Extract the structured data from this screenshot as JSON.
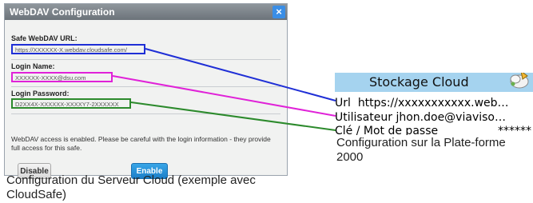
{
  "dialog": {
    "title": "WebDAV Configuration",
    "close_glyph": "×",
    "url_label": "Safe WebDAV URL:",
    "url_value": "https://XXXXXX-X.webdav.cloudsafe.com/",
    "login_label": "Login Name:",
    "login_value": "XXXXXX-XXXX@dsu.com",
    "password_label": "Login Password:",
    "password_value": "D2XX4X-XXXXXX-XXXXY7-2XXXXXX",
    "warning": "WebDAV access is enabled. Please be careful with the login information - they provide full access for this safe.",
    "disable_label": "Disable",
    "enable_label": "Enable"
  },
  "caption_left": "Configuration du Serveur Cloud (exemple avec CloudSafe)",
  "panel": {
    "title": "Stockage Cloud",
    "rows": [
      {
        "label": "Url",
        "value": "https://xxxxxxxxxxx.web…"
      },
      {
        "label": "Utilisateur",
        "value": "jhon.doe@viaviso…"
      },
      {
        "label": "Clé / Mot de passe",
        "value": "******"
      }
    ],
    "icon": "cloud-storage-icon"
  },
  "caption_right": "Configuration sur la Plate-forme 2000",
  "colors": {
    "url_highlight": "#1f2fd6",
    "login_highlight": "#e022d8",
    "password_highlight": "#2c8a2c",
    "panel_header": "#a5d3ef",
    "enable_button": "#1d7fc8"
  }
}
